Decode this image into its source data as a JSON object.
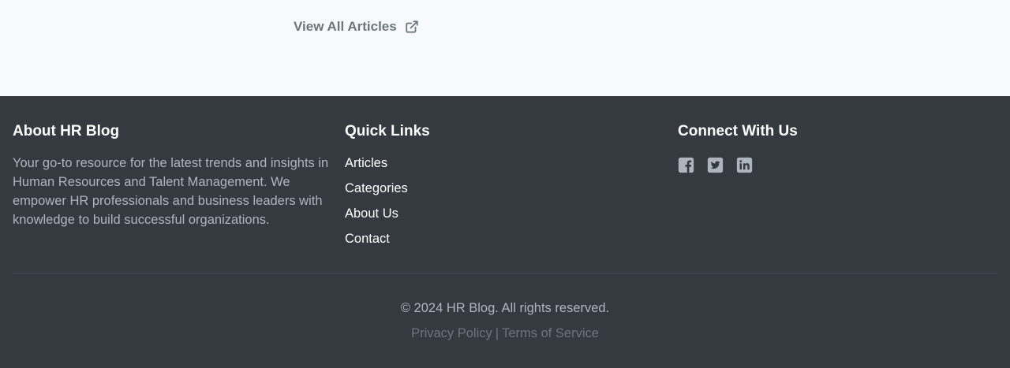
{
  "top": {
    "view_all_label": "View All Articles",
    "view_all_icon": "external-link-icon"
  },
  "footer": {
    "about": {
      "heading": "About HR Blog",
      "text": "Your go-to resource for the latest trends and insights in Human Resources and Talent Management. We empower HR professionals and business leaders with knowledge to build successful organizations."
    },
    "quick_links": {
      "heading": "Quick Links",
      "items": [
        {
          "label": "Articles"
        },
        {
          "label": "Categories"
        },
        {
          "label": "About Us"
        },
        {
          "label": "Contact"
        }
      ]
    },
    "connect": {
      "heading": "Connect With Us",
      "icons": [
        "facebook-icon",
        "twitter-icon",
        "linkedin-icon"
      ]
    },
    "copyright": "© 2024 HR Blog. All rights reserved.",
    "legal": {
      "privacy_label": "Privacy Policy",
      "separator": "|",
      "terms_label": "Terms of Service"
    }
  },
  "colors": {
    "footer_bg": "#343a40",
    "page_bg": "#f8f9fa",
    "muted_text": "#adb5bd",
    "link_muted": "#6c757d",
    "icon": "#adb5bd"
  }
}
